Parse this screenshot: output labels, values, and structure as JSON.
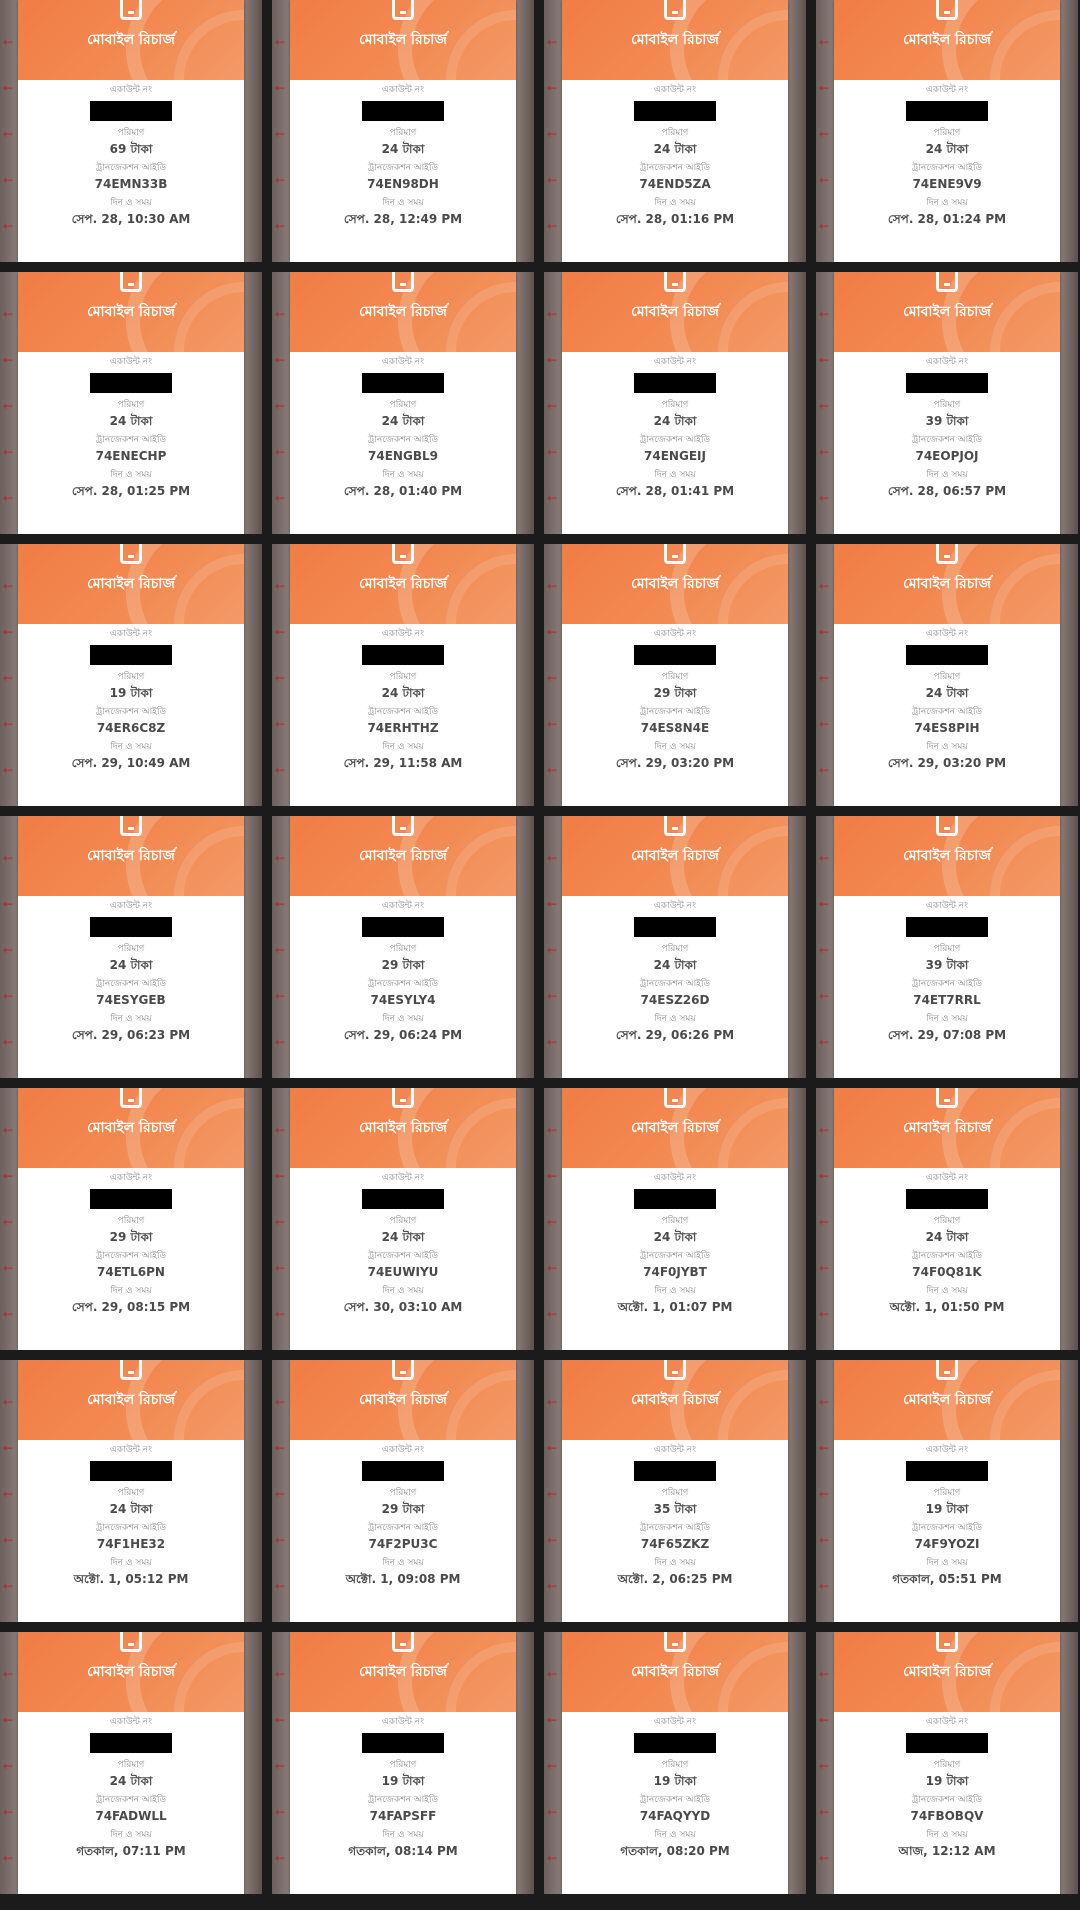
{
  "cards": [
    {
      "title": "মোবাইল রিচার্জ",
      "account_label": "একাউন্ট নং",
      "amount_label": "পরিমাণ",
      "amount": "69 টাকা",
      "txn_label": "ট্রানজেকশন আইডি",
      "txn_id": "74EMN33B",
      "datetime_label": "দিন ও সময়",
      "datetime": "সেপ. 28, 10:30 AM"
    },
    {
      "title": "মোবাইল রিচার্জ",
      "account_label": "একাউন্ট নং",
      "amount_label": "পরিমাণ",
      "amount": "24 টাকা",
      "txn_label": "ট্রানজেকশন আইডি",
      "txn_id": "74EN98DH",
      "datetime_label": "দিন ও সময়",
      "datetime": "সেপ. 28, 12:49 PM"
    },
    {
      "title": "মোবাইল রিচার্জ",
      "account_label": "একাউন্ট নং",
      "amount_label": "পরিমাণ",
      "amount": "24 টাকা",
      "txn_label": "ট্রানজেকশন আইডি",
      "txn_id": "74END5ZA",
      "datetime_label": "দিন ও সময়",
      "datetime": "সেপ. 28, 01:16 PM"
    },
    {
      "title": "মোবাইল রিচার্জ",
      "account_label": "একাউন্ট নং",
      "amount_label": "পরিমাণ",
      "amount": "24 টাকা",
      "txn_label": "ট্রানজেকশন আইডি",
      "txn_id": "74ENE9V9",
      "datetime_label": "দিন ও সময়",
      "datetime": "সেপ. 28, 01:24 PM"
    },
    {
      "title": "মোবাইল রিচার্জ",
      "account_label": "একাউন্ট নং",
      "amount_label": "পরিমাণ",
      "amount": "24 টাকা",
      "txn_label": "ট্রানজেকশন আইডি",
      "txn_id": "74ENECHP",
      "datetime_label": "দিন ও সময়",
      "datetime": "সেপ. 28, 01:25 PM"
    },
    {
      "title": "মোবাইল রিচার্জ",
      "account_label": "একাউন্ট নং",
      "amount_label": "পরিমাণ",
      "amount": "24 টাকা",
      "txn_label": "ট্রানজেকশন আইডি",
      "txn_id": "74ENGBL9",
      "datetime_label": "দিন ও সময়",
      "datetime": "সেপ. 28, 01:40 PM"
    },
    {
      "title": "মোবাইল রিচার্জ",
      "account_label": "একাউন্ট নং",
      "amount_label": "পরিমাণ",
      "amount": "24 টাকা",
      "txn_label": "ট্রানজেকশন আইডি",
      "txn_id": "74ENGEIJ",
      "datetime_label": "দিন ও সময়",
      "datetime": "সেপ. 28, 01:41 PM"
    },
    {
      "title": "মোবাইল রিচার্জ",
      "account_label": "একাউন্ট নং",
      "amount_label": "পরিমাণ",
      "amount": "39 টাকা",
      "txn_label": "ট্রানজেকশন আইডি",
      "txn_id": "74EOPJOJ",
      "datetime_label": "দিন ও সময়",
      "datetime": "সেপ. 28, 06:57 PM"
    },
    {
      "title": "মোবাইল রিচার্জ",
      "account_label": "একাউন্ট নং",
      "amount_label": "পরিমাণ",
      "amount": "19 টাকা",
      "txn_label": "ট্রানজেকশন আইডি",
      "txn_id": "74ER6C8Z",
      "datetime_label": "দিন ও সময়",
      "datetime": "সেপ. 29, 10:49 AM"
    },
    {
      "title": "মোবাইল রিচার্জ",
      "account_label": "একাউন্ট নং",
      "amount_label": "পরিমাণ",
      "amount": "24 টাকা",
      "txn_label": "ট্রানজেকশন আইডি",
      "txn_id": "74ERHTHZ",
      "datetime_label": "দিন ও সময়",
      "datetime": "সেপ. 29, 11:58 AM"
    },
    {
      "title": "মোবাইল রিচার্জ",
      "account_label": "একাউন্ট নং",
      "amount_label": "পরিমাণ",
      "amount": "29 টাকা",
      "txn_label": "ট্রানজেকশন আইডি",
      "txn_id": "74ES8N4E",
      "datetime_label": "দিন ও সময়",
      "datetime": "সেপ. 29, 03:20 PM"
    },
    {
      "title": "মোবাইল রিচার্জ",
      "account_label": "একাউন্ট নং",
      "amount_label": "পরিমাণ",
      "amount": "24 টাকা",
      "txn_label": "ট্রানজেকশন আইডি",
      "txn_id": "74ES8PIH",
      "datetime_label": "দিন ও সময়",
      "datetime": "সেপ. 29, 03:20 PM"
    },
    {
      "title": "মোবাইল রিচার্জ",
      "account_label": "একাউন্ট নং",
      "amount_label": "পরিমাণ",
      "amount": "24 টাকা",
      "txn_label": "ট্রানজেকশন আইডি",
      "txn_id": "74ESYGEB",
      "datetime_label": "দিন ও সময়",
      "datetime": "সেপ. 29, 06:23 PM"
    },
    {
      "title": "মোবাইল রিচার্জ",
      "account_label": "একাউন্ট নং",
      "amount_label": "পরিমাণ",
      "amount": "29 টাকা",
      "txn_label": "ট্রানজেকশন আইডি",
      "txn_id": "74ESYLY4",
      "datetime_label": "দিন ও সময়",
      "datetime": "সেপ. 29, 06:24 PM"
    },
    {
      "title": "মোবাইল রিচার্জ",
      "account_label": "একাউন্ট নং",
      "amount_label": "পরিমাণ",
      "amount": "24 টাকা",
      "txn_label": "ট্রানজেকশন আইডি",
      "txn_id": "74ESZ26D",
      "datetime_label": "দিন ও সময়",
      "datetime": "সেপ. 29, 06:26 PM"
    },
    {
      "title": "মোবাইল রিচার্জ",
      "account_label": "একাউন্ট নং",
      "amount_label": "পরিমাণ",
      "amount": "39 টাকা",
      "txn_label": "ট্রানজেকশন আইডি",
      "txn_id": "74ET7RRL",
      "datetime_label": "দিন ও সময়",
      "datetime": "সেপ. 29, 07:08 PM"
    },
    {
      "title": "মোবাইল রিচার্জ",
      "account_label": "একাউন্ট নং",
      "amount_label": "পরিমাণ",
      "amount": "29 টাকা",
      "txn_label": "ট্রানজেকশন আইডি",
      "txn_id": "74ETL6PN",
      "datetime_label": "দিন ও সময়",
      "datetime": "সেপ. 29, 08:15 PM"
    },
    {
      "title": "মোবাইল রিচার্জ",
      "account_label": "একাউন্ট নং",
      "amount_label": "পরিমাণ",
      "amount": "24 টাকা",
      "txn_label": "ট্রানজেকশন আইডি",
      "txn_id": "74EUWIYU",
      "datetime_label": "দিন ও সময়",
      "datetime": "সেপ. 30, 03:10 AM"
    },
    {
      "title": "মোবাইল রিচার্জ",
      "account_label": "একাউন্ট নং",
      "amount_label": "পরিমাণ",
      "amount": "24 টাকা",
      "txn_label": "ট্রানজেকশন আইডি",
      "txn_id": "74F0JYBT",
      "datetime_label": "দিন ও সময়",
      "datetime": "অক্টো. 1, 01:07 PM"
    },
    {
      "title": "মোবাইল রিচার্জ",
      "account_label": "একাউন্ট নং",
      "amount_label": "পরিমাণ",
      "amount": "24 টাকা",
      "txn_label": "ট্রানজেকশন আইডি",
      "txn_id": "74F0Q81K",
      "datetime_label": "দিন ও সময়",
      "datetime": "অক্টো. 1, 01:50 PM"
    },
    {
      "title": "মোবাইল রিচার্জ",
      "account_label": "একাউন্ট নং",
      "amount_label": "পরিমাণ",
      "amount": "24 টাকা",
      "txn_label": "ট্রানজেকশন আইডি",
      "txn_id": "74F1HE32",
      "datetime_label": "দিন ও সময়",
      "datetime": "অক্টো. 1, 05:12 PM"
    },
    {
      "title": "মোবাইল রিচার্জ",
      "account_label": "একাউন্ট নং",
      "amount_label": "পরিমাণ",
      "amount": "29 টাকা",
      "txn_label": "ট্রানজেকশন আইডি",
      "txn_id": "74F2PU3C",
      "datetime_label": "দিন ও সময়",
      "datetime": "অক্টো. 1, 09:08 PM"
    },
    {
      "title": "মোবাইল রিচার্জ",
      "account_label": "একাউন্ট নং",
      "amount_label": "পরিমাণ",
      "amount": "35 টাকা",
      "txn_label": "ট্রানজেকশন আইডি",
      "txn_id": "74F65ZKZ",
      "datetime_label": "দিন ও সময়",
      "datetime": "অক্টো. 2, 06:25 PM"
    },
    {
      "title": "মোবাইল রিচার্জ",
      "account_label": "একাউন্ট নং",
      "amount_label": "পরিমাণ",
      "amount": "19 টাকা",
      "txn_label": "ট্রানজেকশন আইডি",
      "txn_id": "74F9YOZI",
      "datetime_label": "দিন ও সময়",
      "datetime": "গতকাল, 05:51 PM"
    },
    {
      "title": "মোবাইল রিচার্জ",
      "account_label": "একাউন্ট নং",
      "amount_label": "পরিমাণ",
      "amount": "24 টাকা",
      "txn_label": "ট্রানজেকশন আইডি",
      "txn_id": "74FADWLL",
      "datetime_label": "দিন ও সময়",
      "datetime": "গতকাল, 07:11 PM"
    },
    {
      "title": "মোবাইল রিচার্জ",
      "account_label": "একাউন্ট নং",
      "amount_label": "পরিমাণ",
      "amount": "19 টাকা",
      "txn_label": "ট্রানজেকশন আইডি",
      "txn_id": "74FAPSFF",
      "datetime_label": "দিন ও সময়",
      "datetime": "গতকাল, 08:14 PM"
    },
    {
      "title": "মোবাইল রিচার্জ",
      "account_label": "একাউন্ট নং",
      "amount_label": "পরিমাণ",
      "amount": "19 টাকা",
      "txn_label": "ট্রানজেকশন আইডি",
      "txn_id": "74FAQYYD",
      "datetime_label": "দিন ও সময়",
      "datetime": "গতকাল, 08:20 PM"
    },
    {
      "title": "মোবাইল রিচার্জ",
      "account_label": "একাউন্ট নং",
      "amount_label": "পরিমাণ",
      "amount": "19 টাকা",
      "txn_label": "ট্রানজেকশন আইডি",
      "txn_id": "74FBOBQV",
      "datetime_label": "দিন ও সময়",
      "datetime": "আজ, 12:12 AM"
    }
  ],
  "colors": {
    "header_orange": "#f07d45",
    "background": "#1b1b1b",
    "redaction": "#000000"
  },
  "icons": {
    "header": "mobile-phone-icon",
    "side": "left-arrow-icon"
  }
}
